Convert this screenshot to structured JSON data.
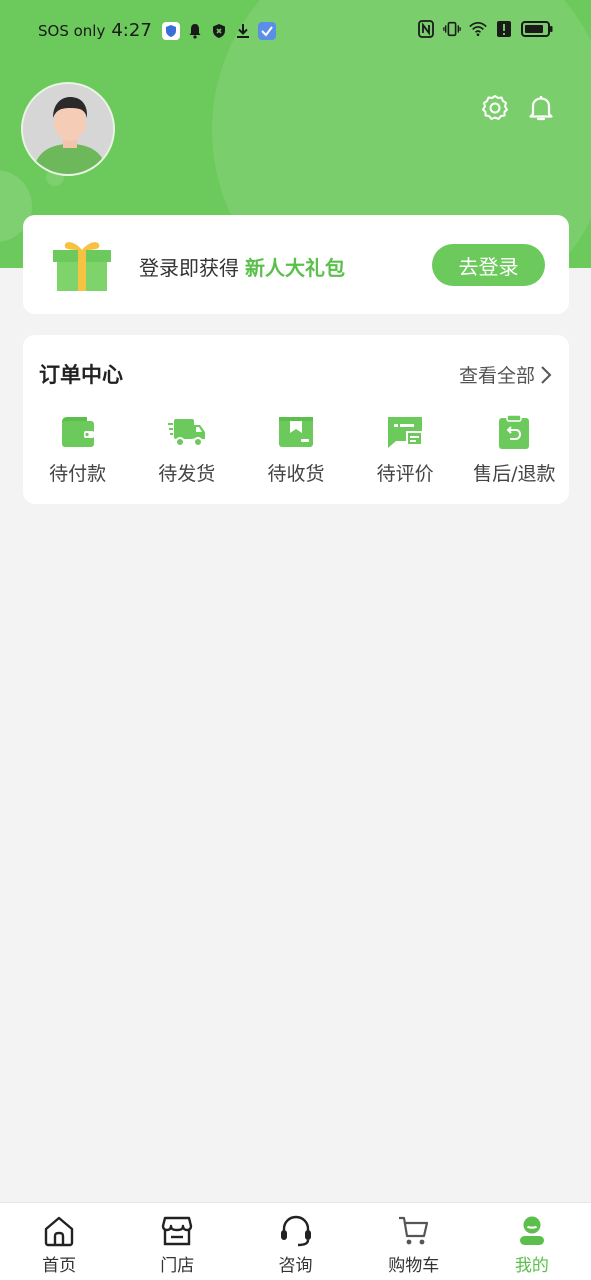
{
  "status_bar": {
    "carrier": "SOS only",
    "time": "4:27"
  },
  "header": {
    "settings_icon": "gear-icon",
    "notifications_icon": "bell-icon"
  },
  "login_banner": {
    "text": "登录即获得",
    "highlight": "新人大礼包",
    "button": "去登录"
  },
  "order_center": {
    "title": "订单中心",
    "view_all": "查看全部",
    "items": [
      {
        "label": "待付款",
        "icon": "wallet-icon"
      },
      {
        "label": "待发货",
        "icon": "truck-icon"
      },
      {
        "label": "待收货",
        "icon": "box-icon"
      },
      {
        "label": "待评价",
        "icon": "comment-icon"
      },
      {
        "label": "售后/退款",
        "icon": "refund-icon"
      }
    ]
  },
  "bottom_nav": [
    {
      "label": "首页",
      "icon": "home-icon"
    },
    {
      "label": "门店",
      "icon": "store-icon"
    },
    {
      "label": "咨询",
      "icon": "headset-icon"
    },
    {
      "label": "购物车",
      "icon": "cart-icon"
    },
    {
      "label": "我的",
      "icon": "profile-icon",
      "active": true
    }
  ],
  "colors": {
    "brand": "#6cc95c",
    "highlight_text": "#5bbf4c",
    "background": "#f3f3f3"
  }
}
